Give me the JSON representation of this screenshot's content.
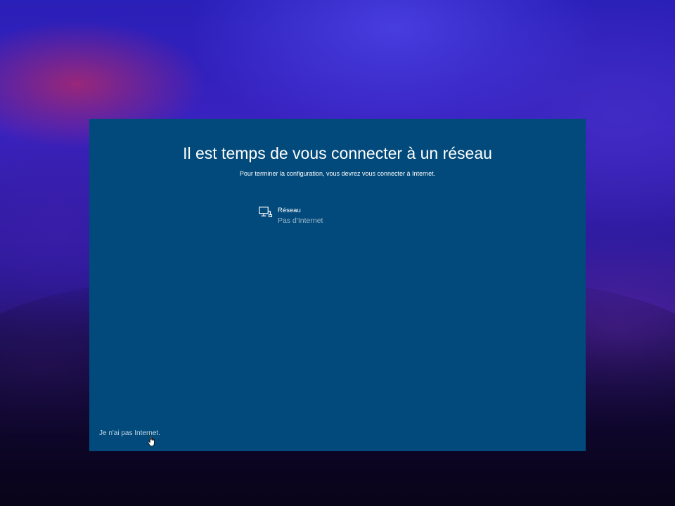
{
  "setup": {
    "title": "Il est temps de vous connecter à un réseau",
    "subtitle": "Pour terminer la configuration, vous devrez vous connecter à Internet.",
    "networks": [
      {
        "icon": "wired-network-icon",
        "name": "Réseau",
        "status": "Pas d'Internet"
      }
    ],
    "no_internet_link": "Je n'ai pas Internet."
  },
  "colors": {
    "panel_background": "#014a7b",
    "title_text": "#ffffff",
    "status_text": "#9fb9cf",
    "link_text": "#c6d8e8"
  }
}
